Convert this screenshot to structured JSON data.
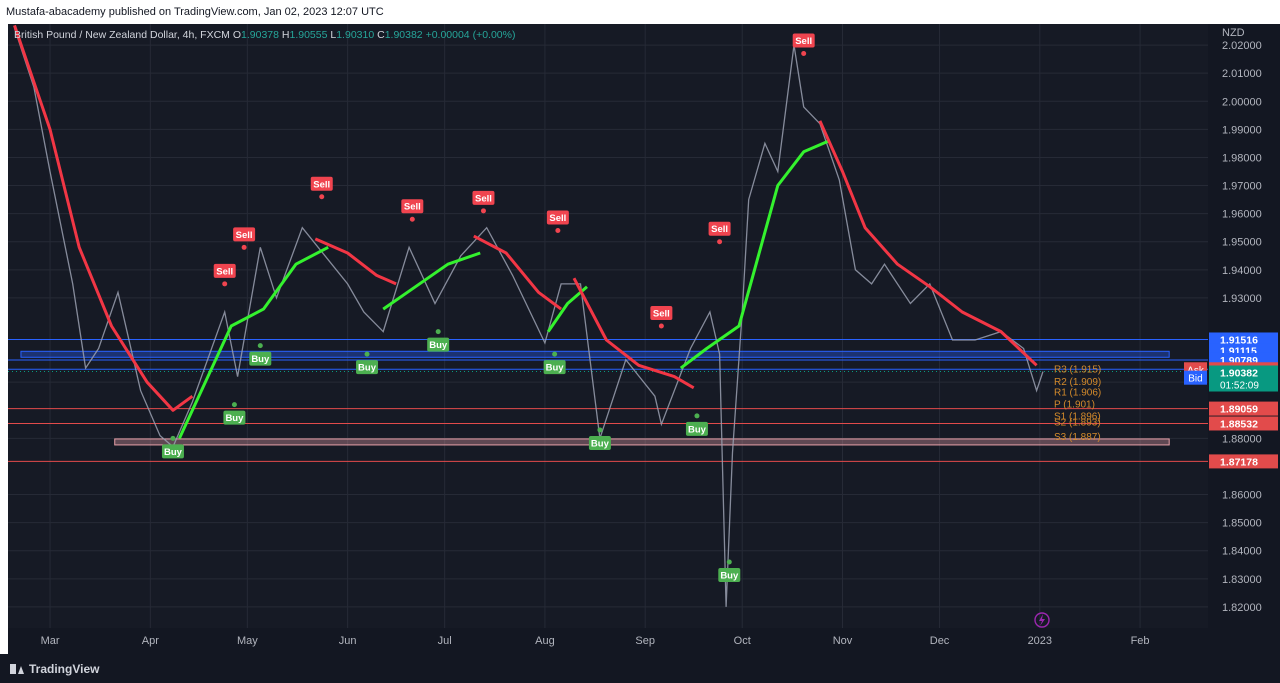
{
  "header": {
    "publish_line": "Mustafa-abacademy published on TradingView.com, Jan 02, 2023 12:07 UTC",
    "symbol_line": "British Pound / New Zealand Dollar, 4h, FXCM",
    "ohlc": [
      {
        "key": "O",
        "value": "1.90378"
      },
      {
        "key": "H",
        "value": "1.90555"
      },
      {
        "key": "L",
        "value": "1.90310"
      },
      {
        "key": "C",
        "value": "1.90382"
      }
    ],
    "change": "+0.00004 (+0.00%)"
  },
  "footer": {
    "logo_text": "TradingView"
  },
  "colors": {
    "background": "#161a25",
    "grid": "#262a36",
    "ma_red": "#f23645",
    "ma_green": "#34f22e",
    "buy": "#4caf50",
    "sell": "#f0444f",
    "blue_level": "#2962ff",
    "red_level": "#e24b4b",
    "pivot": "#d38a2b"
  },
  "chart_data": {
    "type": "line",
    "title": "",
    "xlabel": "",
    "ylabel": "NZD",
    "x_range": [
      "2022-02-16",
      "2023-02-22"
    ],
    "ylim": [
      1.8125,
      2.0275
    ],
    "y_ticks": [
      "2.02000",
      "2.01000",
      "2.00000",
      "1.99000",
      "1.98000",
      "1.97000",
      "1.96000",
      "1.95000",
      "1.94000",
      "1.93000",
      "1.90000",
      "1.88000",
      "1.86000",
      "1.85000",
      "1.84000",
      "1.83000",
      "1.82000"
    ],
    "x_ticks": [
      {
        "label": "Mar",
        "date": "2022-03-01"
      },
      {
        "label": "Apr",
        "date": "2022-04-01"
      },
      {
        "label": "May",
        "date": "2022-05-01"
      },
      {
        "label": "Jun",
        "date": "2022-06-01"
      },
      {
        "label": "Jul",
        "date": "2022-07-01"
      },
      {
        "label": "Aug",
        "date": "2022-08-01"
      },
      {
        "label": "Sep",
        "date": "2022-09-01"
      },
      {
        "label": "Oct",
        "date": "2022-10-01"
      },
      {
        "label": "Nov",
        "date": "2022-11-01"
      },
      {
        "label": "Dec",
        "date": "2022-12-01"
      },
      {
        "label": "2023",
        "date": "2023-01-01"
      },
      {
        "label": "Feb",
        "date": "2023-02-01"
      }
    ],
    "price_series": [
      {
        "x": "2022-02-18",
        "y": 2.026
      },
      {
        "x": "2022-02-24",
        "y": 2.005
      },
      {
        "x": "2022-03-01",
        "y": 1.975
      },
      {
        "x": "2022-03-08",
        "y": 1.935
      },
      {
        "x": "2022-03-12",
        "y": 1.905
      },
      {
        "x": "2022-03-16",
        "y": 1.912
      },
      {
        "x": "2022-03-22",
        "y": 1.932
      },
      {
        "x": "2022-03-29",
        "y": 1.897
      },
      {
        "x": "2022-04-04",
        "y": 1.881
      },
      {
        "x": "2022-04-08",
        "y": 1.877
      },
      {
        "x": "2022-04-14",
        "y": 1.893
      },
      {
        "x": "2022-04-24",
        "y": 1.925
      },
      {
        "x": "2022-04-28",
        "y": 1.902
      },
      {
        "x": "2022-05-05",
        "y": 1.948
      },
      {
        "x": "2022-05-10",
        "y": 1.93
      },
      {
        "x": "2022-05-18",
        "y": 1.955
      },
      {
        "x": "2022-05-25",
        "y": 1.945
      },
      {
        "x": "2022-06-01",
        "y": 1.935
      },
      {
        "x": "2022-06-06",
        "y": 1.925
      },
      {
        "x": "2022-06-12",
        "y": 1.918
      },
      {
        "x": "2022-06-20",
        "y": 1.948
      },
      {
        "x": "2022-06-28",
        "y": 1.928
      },
      {
        "x": "2022-07-06",
        "y": 1.945
      },
      {
        "x": "2022-07-14",
        "y": 1.955
      },
      {
        "x": "2022-07-22",
        "y": 1.938
      },
      {
        "x": "2022-08-01",
        "y": 1.914
      },
      {
        "x": "2022-08-06",
        "y": 1.935
      },
      {
        "x": "2022-08-12",
        "y": 1.935
      },
      {
        "x": "2022-08-18",
        "y": 1.88
      },
      {
        "x": "2022-08-26",
        "y": 1.908
      },
      {
        "x": "2022-09-04",
        "y": 1.895
      },
      {
        "x": "2022-09-06",
        "y": 1.885
      },
      {
        "x": "2022-09-15",
        "y": 1.912
      },
      {
        "x": "2022-09-21",
        "y": 1.925
      },
      {
        "x": "2022-09-24",
        "y": 1.91
      },
      {
        "x": "2022-09-26",
        "y": 1.82
      },
      {
        "x": "2022-09-28",
        "y": 1.875
      },
      {
        "x": "2022-10-01",
        "y": 1.925
      },
      {
        "x": "2022-10-03",
        "y": 1.965
      },
      {
        "x": "2022-10-08",
        "y": 1.985
      },
      {
        "x": "2022-10-12",
        "y": 1.975
      },
      {
        "x": "2022-10-17",
        "y": 2.02
      },
      {
        "x": "2022-10-20",
        "y": 1.998
      },
      {
        "x": "2022-10-25",
        "y": 1.992
      },
      {
        "x": "2022-10-31",
        "y": 1.972
      },
      {
        "x": "2022-11-05",
        "y": 1.94
      },
      {
        "x": "2022-11-10",
        "y": 1.935
      },
      {
        "x": "2022-11-14",
        "y": 1.942
      },
      {
        "x": "2022-11-22",
        "y": 1.928
      },
      {
        "x": "2022-11-28",
        "y": 1.935
      },
      {
        "x": "2022-12-05",
        "y": 1.915
      },
      {
        "x": "2022-12-12",
        "y": 1.915
      },
      {
        "x": "2022-12-20",
        "y": 1.918
      },
      {
        "x": "2022-12-27",
        "y": 1.912
      },
      {
        "x": "2022-12-31",
        "y": 1.897
      },
      {
        "x": "2023-01-02",
        "y": 1.9038
      }
    ],
    "series": [
      {
        "name": "",
        "color": "#f23645",
        "role": "trend-ma",
        "values": [
          {
            "x": "2022-02-18",
            "y": 2.027
          },
          {
            "x": "2022-03-01",
            "y": 1.99
          },
          {
            "x": "2022-03-10",
            "y": 1.948
          },
          {
            "x": "2022-03-20",
            "y": 1.92
          },
          {
            "x": "2022-03-31",
            "y": 1.9
          },
          {
            "x": "2022-04-08",
            "y": 1.89
          },
          {
            "x": "2022-04-14",
            "y": 1.895
          }
        ]
      },
      {
        "name": "",
        "color": "#34f22e",
        "role": "trend-ma",
        "values": [
          {
            "x": "2022-04-10",
            "y": 1.88
          },
          {
            "x": "2022-04-18",
            "y": 1.9
          },
          {
            "x": "2022-04-26",
            "y": 1.92
          },
          {
            "x": "2022-05-06",
            "y": 1.926
          },
          {
            "x": "2022-05-16",
            "y": 1.942
          },
          {
            "x": "2022-05-26",
            "y": 1.948
          }
        ]
      },
      {
        "name": "",
        "color": "#f23645",
        "role": "trend-ma",
        "values": [
          {
            "x": "2022-05-22",
            "y": 1.951
          },
          {
            "x": "2022-06-01",
            "y": 1.946
          },
          {
            "x": "2022-06-10",
            "y": 1.938
          },
          {
            "x": "2022-06-16",
            "y": 1.935
          }
        ]
      },
      {
        "name": "",
        "color": "#34f22e",
        "role": "trend-ma",
        "values": [
          {
            "x": "2022-06-12",
            "y": 1.926
          },
          {
            "x": "2022-06-22",
            "y": 1.934
          },
          {
            "x": "2022-07-02",
            "y": 1.942
          },
          {
            "x": "2022-07-12",
            "y": 1.946
          }
        ]
      },
      {
        "name": "",
        "color": "#f23645",
        "role": "trend-ma",
        "values": [
          {
            "x": "2022-07-10",
            "y": 1.952
          },
          {
            "x": "2022-07-20",
            "y": 1.946
          },
          {
            "x": "2022-07-30",
            "y": 1.932
          },
          {
            "x": "2022-08-06",
            "y": 1.926
          }
        ]
      },
      {
        "name": "",
        "color": "#34f22e",
        "role": "trend-ma",
        "values": [
          {
            "x": "2022-08-02",
            "y": 1.918
          },
          {
            "x": "2022-08-08",
            "y": 1.928
          },
          {
            "x": "2022-08-14",
            "y": 1.934
          }
        ]
      },
      {
        "name": "",
        "color": "#f23645",
        "role": "trend-ma",
        "values": [
          {
            "x": "2022-08-10",
            "y": 1.937
          },
          {
            "x": "2022-08-20",
            "y": 1.915
          },
          {
            "x": "2022-08-30",
            "y": 1.906
          },
          {
            "x": "2022-09-10",
            "y": 1.902
          },
          {
            "x": "2022-09-16",
            "y": 1.898
          }
        ]
      },
      {
        "name": "",
        "color": "#34f22e",
        "role": "trend-ma",
        "values": [
          {
            "x": "2022-09-12",
            "y": 1.905
          },
          {
            "x": "2022-09-20",
            "y": 1.912
          },
          {
            "x": "2022-09-30",
            "y": 1.92
          },
          {
            "x": "2022-10-06",
            "y": 1.945
          },
          {
            "x": "2022-10-12",
            "y": 1.97
          },
          {
            "x": "2022-10-20",
            "y": 1.982
          },
          {
            "x": "2022-10-28",
            "y": 1.986
          }
        ]
      },
      {
        "name": "",
        "color": "#f23645",
        "role": "trend-ma",
        "values": [
          {
            "x": "2022-10-25",
            "y": 1.993
          },
          {
            "x": "2022-11-01",
            "y": 1.975
          },
          {
            "x": "2022-11-08",
            "y": 1.955
          },
          {
            "x": "2022-11-18",
            "y": 1.942
          },
          {
            "x": "2022-11-28",
            "y": 1.934
          },
          {
            "x": "2022-12-08",
            "y": 1.925
          },
          {
            "x": "2022-12-20",
            "y": 1.918
          },
          {
            "x": "2022-12-31",
            "y": 1.906
          }
        ]
      }
    ],
    "signals": [
      {
        "type": "Buy",
        "x": "2022-04-08",
        "y": 1.88
      },
      {
        "type": "Sell",
        "x": "2022-04-24",
        "y": 1.935
      },
      {
        "type": "Sell",
        "x": "2022-04-30",
        "y": 1.948
      },
      {
        "type": "Buy",
        "x": "2022-04-27",
        "y": 1.892
      },
      {
        "type": "Buy",
        "x": "2022-05-05",
        "y": 1.913
      },
      {
        "type": "Sell",
        "x": "2022-05-24",
        "y": 1.966
      },
      {
        "type": "Buy",
        "x": "2022-06-07",
        "y": 1.91
      },
      {
        "type": "Sell",
        "x": "2022-06-21",
        "y": 1.958
      },
      {
        "type": "Buy",
        "x": "2022-06-29",
        "y": 1.918
      },
      {
        "type": "Sell",
        "x": "2022-07-13",
        "y": 1.961
      },
      {
        "type": "Sell",
        "x": "2022-08-05",
        "y": 1.954
      },
      {
        "type": "Buy",
        "x": "2022-08-04",
        "y": 1.91
      },
      {
        "type": "Buy",
        "x": "2022-08-18",
        "y": 1.883
      },
      {
        "type": "Sell",
        "x": "2022-09-06",
        "y": 1.92
      },
      {
        "type": "Buy",
        "x": "2022-09-17",
        "y": 1.888
      },
      {
        "type": "Sell",
        "x": "2022-09-24",
        "y": 1.95
      },
      {
        "type": "Buy",
        "x": "2022-09-27",
        "y": 1.836
      },
      {
        "type": "Sell",
        "x": "2022-10-20",
        "y": 2.017
      }
    ],
    "zones": [
      {
        "name": "blue-zone",
        "from": "2022-02-20",
        "to": "2023-02-10",
        "y_top": 1.911,
        "y_bottom": 1.9095,
        "color": "#2962ff"
      },
      {
        "name": "pink-zone",
        "from": "2022-03-21",
        "to": "2023-02-10",
        "y_top": 1.8798,
        "y_bottom": 1.878,
        "color": "#e8a0a8"
      }
    ],
    "horizontal_levels": [
      {
        "value": 1.9152,
        "color": "#2962ff"
      },
      {
        "value": 1.9079,
        "color": "#2962ff"
      },
      {
        "value": 1.9046,
        "color": "#2962ff"
      },
      {
        "value": 1.8906,
        "color": "#e24b4b"
      },
      {
        "value": 1.8853,
        "color": "#e24b4b"
      },
      {
        "value": 1.8718,
        "color": "#e24b4b"
      }
    ],
    "pivots": [
      {
        "label": "R3 (1.915)",
        "y": 1.9045
      },
      {
        "label": "R2 (1.909)",
        "y": 1.9
      },
      {
        "label": "R1 (1.906)",
        "y": 1.8964
      },
      {
        "label": "P (1.901)",
        "y": 1.892
      },
      {
        "label": "S1 (1.896)",
        "y": 1.8877
      },
      {
        "label": "S2 (1.893)",
        "y": 1.8856
      },
      {
        "label": "S3 (1.887)",
        "y": 1.8805
      }
    ],
    "price_tags": [
      {
        "label": "1.91516",
        "y": 1.9152,
        "color": "#2962ff",
        "side_label": ""
      },
      {
        "label": "1.91115",
        "y": 1.9112,
        "color": "#2962ff",
        "side_label": ""
      },
      {
        "label": "1.90789",
        "y": 1.9079,
        "color": "#2962ff",
        "side_label": ""
      },
      {
        "label": "1.90455",
        "y": 1.9046,
        "color": "#e24b4b",
        "side_label": "Ask"
      },
      {
        "label": "1.90382",
        "y": 1.9016,
        "color": "#2962ff",
        "side_label": "Bid"
      },
      {
        "label": "1.89059",
        "y": 1.8906,
        "color": "#e24b4b",
        "side_label": ""
      },
      {
        "label": "1.88532",
        "y": 1.8853,
        "color": "#e24b4b",
        "side_label": ""
      },
      {
        "label": "1.87178",
        "y": 1.8718,
        "color": "#e24b4b",
        "side_label": ""
      }
    ],
    "last_price": {
      "label": "1.90382",
      "countdown": "01:52:09",
      "y": 1.9038,
      "color": "#089981"
    },
    "grid": true
  }
}
